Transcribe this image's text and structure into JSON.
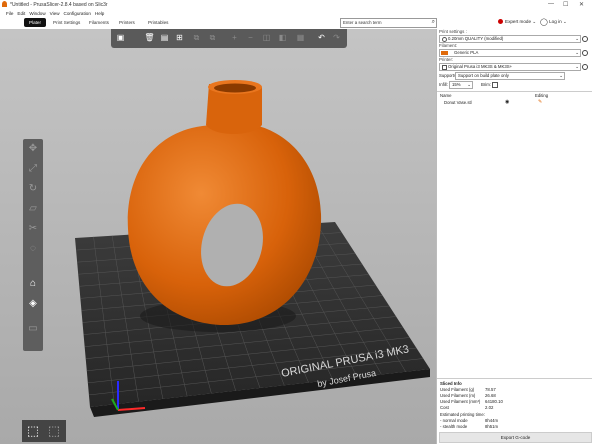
{
  "window": {
    "title": "*Untitled - PrusaSlicer-2.8.4 based on Slic3r",
    "controls": [
      "—",
      "☐",
      "✕"
    ]
  },
  "menu": [
    "File",
    "Edit",
    "Window",
    "View",
    "Configuration",
    "Help"
  ],
  "tabs": [
    "Plater",
    "Print Settings",
    "Filaments",
    "Printers",
    "Printables"
  ],
  "search": {
    "placeholder": "Enter a search term"
  },
  "mode": {
    "label": "Expert mode",
    "color": "#cc0000"
  },
  "account": {
    "label": "Log in"
  },
  "bed": {
    "brand": "ORIGINAL PRUSA i3 MK3",
    "maker": "by Josef Prusa"
  },
  "model": {
    "color": "#e06a0a"
  },
  "panel": {
    "print_settings_label": "Print settings :",
    "print_settings_value": "0.20mm QUALITY (modified)",
    "filament_label": "Filament:",
    "filament_value": "Generic PLA",
    "filament_color": "#e06a0a",
    "printer_label": "Printer:",
    "printer_value": "Original Prusa i3 MK3S & MK3S+",
    "supports_label": "Supports:",
    "supports_value": "Support on build plate only",
    "infill_label": "Infill:",
    "infill_value": "15%",
    "brim_label": "Brim:",
    "col_name": "Name",
    "col_editing": "Editing",
    "object_name": "Donut Vase.stl"
  },
  "sliced_info": {
    "title": "Sliced Info",
    "rows": [
      {
        "label": "Used Filament (g)",
        "value": "78.57"
      },
      {
        "label": "Used Filament (m)",
        "value": "26.68"
      },
      {
        "label": "Used Filament (mm³)",
        "value": "64180.10"
      },
      {
        "label": "Cost",
        "value": "2.02"
      },
      {
        "label": "Estimated printing time:",
        "value": ""
      },
      {
        "label": "- normal mode",
        "value": "8h44m"
      },
      {
        "label": "- stealth mode",
        "value": "8h51m"
      }
    ]
  },
  "export_label": "Export G-code"
}
